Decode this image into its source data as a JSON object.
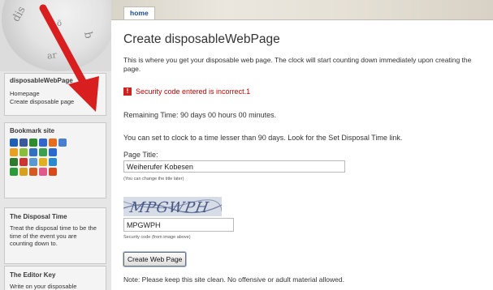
{
  "header": {
    "tab_home": "home"
  },
  "logo": {
    "letters_top": "dis",
    "letters_right": "b",
    "letters_mid": "ö",
    "letters_bottom": "ar"
  },
  "sidebar": {
    "site_block": {
      "title": "disposableWebPage",
      "links": [
        "Homepage",
        "Create disposable page"
      ]
    },
    "bookmark_block": {
      "title": "Bookmark site",
      "icons": [
        [
          "digg-icon",
          "facebook-icon",
          "stumble-icon",
          "delicious-icon",
          "furl-icon",
          "google-icon"
        ],
        [
          "blogmarks-icon",
          "yahoo-icon",
          "magnolia-icon",
          "newsvine-icon",
          "blinklist-icon"
        ],
        [
          "technorati-icon",
          "reddit-icon",
          "spurl-icon",
          "diigo-icon",
          "live-icon"
        ],
        [
          "simpy-icon",
          "windows-icon",
          "blinkbits-icon",
          "youtube-icon",
          "smarking-icon"
        ]
      ],
      "icon_colors": [
        [
          "#1e5fb8",
          "#3b5998",
          "#2e8b2e",
          "#3366cc",
          "#e56e1e",
          "#4a7fd0"
        ],
        [
          "#e8a020",
          "#8bbf3a",
          "#3070c0",
          "#3aa050",
          "#2a6ad0"
        ],
        [
          "#2f7a2f",
          "#cc3333",
          "#5a9ad0",
          "#e0b020",
          "#2a8ad0"
        ],
        [
          "#2a9a3a",
          "#d8a020",
          "#d65a20",
          "#e05a8a",
          "#d84a1a"
        ]
      ]
    },
    "disposal_block": {
      "title": "The Disposal Time",
      "text": "Treat the disposal time to be the time of the event you are counting down to."
    },
    "editor_block": {
      "title": "The Editor Key",
      "text": "Write on your disposable"
    }
  },
  "main": {
    "title": "Create disposableWebPage",
    "intro": "This is where you get your disposable web page. The clock will start counting down immediately upon creating the page.",
    "error": "Security code entered is incorrect.1",
    "remaining": "Remaining Time: 90 days 00 hours 00 minutes.",
    "clock_note": "You can set to clock to a time lesser than 90 days. Look for the Set Disposal Time link.",
    "title_label": "Page Title:",
    "title_value": "Weiherufer Kobesen",
    "title_hint": "(You can change the title later)",
    "captcha_text": "MPGWPH",
    "code_value": "MPGWPH",
    "code_hint": "Security code (from image above)",
    "submit_label": "Create Web Page",
    "clean_note": "Note: Please keep this site clean. No offensive or adult material allowed."
  },
  "colors": {
    "arrow": "#d81e1e",
    "error": "#cc0000",
    "link": "#1a4a8a"
  }
}
